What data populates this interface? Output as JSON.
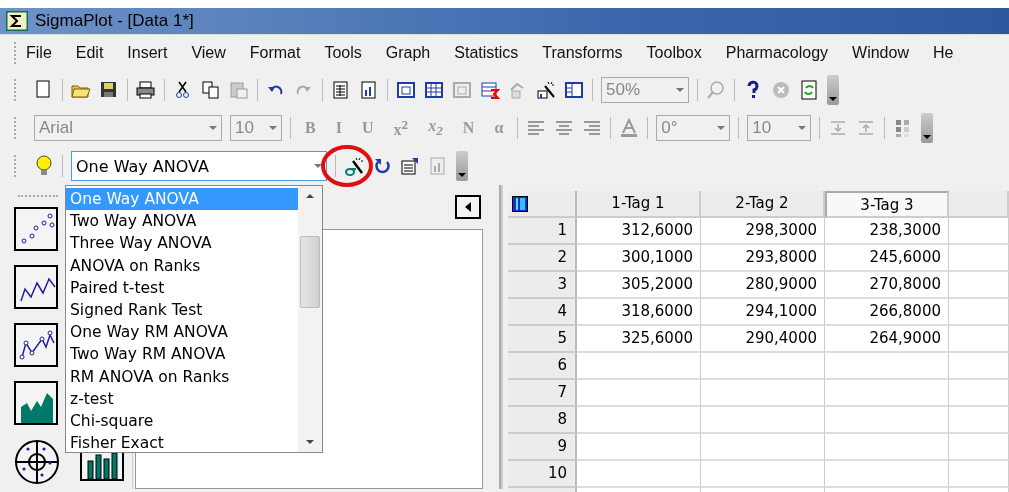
{
  "window": {
    "title": "SigmaPlot - [Data 1*]"
  },
  "menu": [
    {
      "label": "File"
    },
    {
      "label": "Edit"
    },
    {
      "label": "Insert"
    },
    {
      "label": "View"
    },
    {
      "label": "Format"
    },
    {
      "label": "Tools"
    },
    {
      "label": "Graph"
    },
    {
      "label": "Statistics"
    },
    {
      "label": "Transforms"
    },
    {
      "label": "Toolbox"
    },
    {
      "label": "Pharmacology"
    },
    {
      "label": "Window"
    },
    {
      "label": "He"
    }
  ],
  "standard_toolbar": {
    "zoom": "50%"
  },
  "format_toolbar": {
    "font": "Arial",
    "size": "10",
    "buttons": [
      {
        "label": "B",
        "disabled": true
      },
      {
        "label": "I",
        "disabled": true
      },
      {
        "label": "U",
        "disabled": true
      },
      {
        "label": "x$^{2}$",
        "disabled": true
      },
      {
        "label": "x$_{2}$",
        "disabled": true
      },
      {
        "label": "N",
        "disabled": true
      },
      {
        "label": "α",
        "disabled": true
      }
    ],
    "angle": "0°",
    "spacing": "10"
  },
  "statistics_toolbar": {
    "test": "One Way ANOVA",
    "test_list": [
      {
        "label": "One Way ANOVA",
        "selected": true
      },
      {
        "label": "Two Way ANOVA",
        "selected": false
      },
      {
        "label": "Three Way ANOVA",
        "selected": false
      },
      {
        "label": "ANOVA on Ranks",
        "selected": false
      },
      {
        "label": "Paired t-test",
        "selected": false
      },
      {
        "label": "Signed Rank Test",
        "selected": false
      },
      {
        "label": "One Way RM ANOVA",
        "selected": false
      },
      {
        "label": "Two Way RM ANOVA",
        "selected": false
      },
      {
        "label": "RM ANOVA on Ranks",
        "selected": false
      },
      {
        "label": "z-test",
        "selected": false
      },
      {
        "label": "Chi-square",
        "selected": false
      },
      {
        "label": "Fisher Exact",
        "selected": false
      }
    ]
  },
  "worksheet": {
    "columns": [
      {
        "label": "1-Tag 1",
        "selected": false
      },
      {
        "label": "2-Tag 2",
        "selected": false
      },
      {
        "label": "3-Tag 3",
        "selected": true
      }
    ],
    "rows": [
      {
        "number": "1",
        "cells": [
          "312,6000",
          "298,3000",
          "238,3000"
        ]
      },
      {
        "number": "2",
        "cells": [
          "300,1000",
          "293,8000",
          "245,6000"
        ]
      },
      {
        "number": "3",
        "cells": [
          "305,2000",
          "280,9000",
          "270,8000"
        ]
      },
      {
        "number": "4",
        "cells": [
          "318,6000",
          "294,1000",
          "266,8000"
        ]
      },
      {
        "number": "5",
        "cells": [
          "325,6000",
          "290,4000",
          "264,9000"
        ]
      },
      {
        "number": "6"
      },
      {
        "number": "7"
      },
      {
        "number": "8"
      },
      {
        "number": "9"
      },
      {
        "number": "10"
      }
    ]
  }
}
